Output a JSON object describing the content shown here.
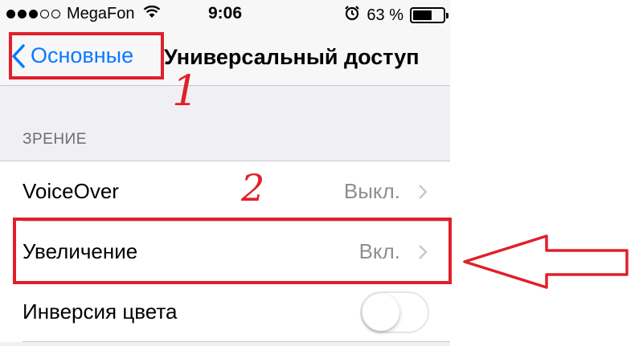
{
  "status_bar": {
    "signal_dots": [
      true,
      true,
      true,
      false,
      false
    ],
    "carrier": "MegaFon",
    "time": "9:06",
    "battery_text": "63 %",
    "battery_level": 0.63
  },
  "nav": {
    "back_label": "Основные",
    "title": "Универсальный доступ"
  },
  "section": {
    "header": "ЗРЕНИЕ",
    "rows": [
      {
        "label": "VoiceOver",
        "detail": "Выкл."
      },
      {
        "label": "Увеличение",
        "detail": "Вкл."
      },
      {
        "label": "Инверсия цвета",
        "toggle": false
      }
    ]
  },
  "annotations": {
    "step1": "1",
    "step2": "2",
    "color": "#e0202a"
  },
  "colors": {
    "accent": "#0a7aff",
    "background": "#efeff4",
    "secondary_text": "#8e8e93"
  }
}
